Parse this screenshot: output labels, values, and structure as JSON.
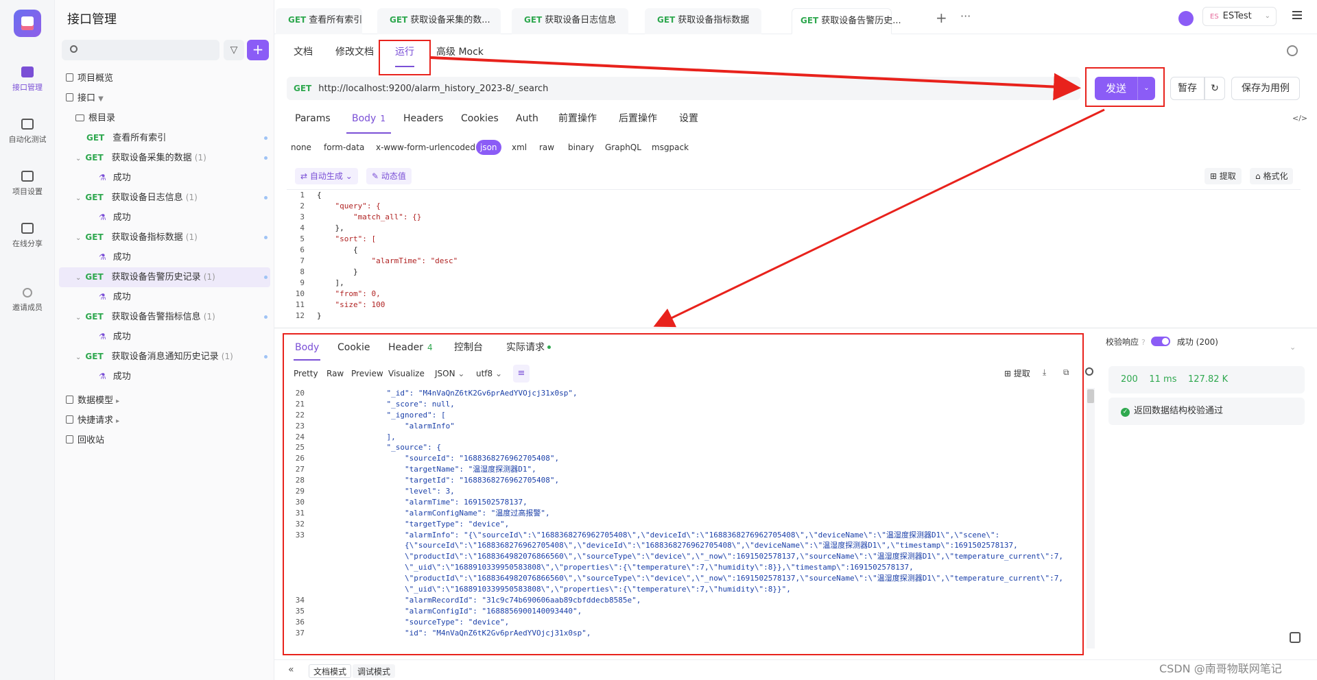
{
  "rail": {
    "items": [
      {
        "label": "接口管理"
      },
      {
        "label": "自动化测试"
      },
      {
        "label": "项目设置"
      },
      {
        "label": "在线分享"
      },
      {
        "label": "邀请成员"
      }
    ]
  },
  "sidebar": {
    "title": "接口管理",
    "overview": "项目概览",
    "api_root": "接口",
    "root_dir": "根目录",
    "apis": [
      {
        "method": "GET",
        "name": "查看所有索引",
        "count": ""
      },
      {
        "method": "GET",
        "name": "获取设备采集的数据",
        "count": "(1)",
        "case": "成功"
      },
      {
        "method": "GET",
        "name": "获取设备日志信息",
        "count": "(1)",
        "case": "成功"
      },
      {
        "method": "GET",
        "name": "获取设备指标数据",
        "count": "(1)",
        "case": "成功"
      },
      {
        "method": "GET",
        "name": "获取设备告警历史记录",
        "count": "(1)",
        "case": "成功"
      },
      {
        "method": "GET",
        "name": "获取设备告警指标信息",
        "count": "(1)",
        "case": "成功"
      },
      {
        "method": "GET",
        "name": "获取设备消息通知历史记录",
        "count": "(1)",
        "case": "成功"
      }
    ],
    "data_model": "数据模型",
    "quick_request": "快捷请求",
    "recycle": "回收站"
  },
  "tabs": [
    {
      "method": "GET",
      "label": "查看所有索引"
    },
    {
      "method": "GET",
      "label": "获取设备采集的数..."
    },
    {
      "method": "GET",
      "label": "获取设备日志信息"
    },
    {
      "method": "GET",
      "label": "获取设备指标数据"
    },
    {
      "method": "GET",
      "label": "获取设备告警历史..."
    }
  ],
  "env": {
    "badge": "ES",
    "name": "ESTest"
  },
  "subtabs": [
    "文档",
    "修改文档",
    "运行",
    "高级 Mock"
  ],
  "request": {
    "method": "GET",
    "url": "http://localhost:9200/alarm_history_2023-8/_search",
    "send": "发送",
    "save_temp": "暂存",
    "save_case": "保存为用例"
  },
  "reqtabs": [
    {
      "label": "Params",
      "n": ""
    },
    {
      "label": "Body",
      "n": "1"
    },
    {
      "label": "Headers",
      "n": ""
    },
    {
      "label": "Cookies",
      "n": ""
    },
    {
      "label": "Auth",
      "n": ""
    },
    {
      "label": "前置操作",
      "n": ""
    },
    {
      "label": "后置操作",
      "n": ""
    },
    {
      "label": "设置",
      "n": ""
    }
  ],
  "bodytypes": [
    "none",
    "form-data",
    "x-www-form-urlencoded",
    "json",
    "xml",
    "raw",
    "binary",
    "GraphQL",
    "msgpack"
  ],
  "body_tools": {
    "auto": "自动生成",
    "dynamic": "动态值",
    "extract": "提取",
    "format": "格式化"
  },
  "request_body": [
    "{",
    "    \"query\": {",
    "        \"match_all\": {}",
    "    },",
    "    \"sort\": [",
    "        {",
    "            \"alarmTime\": \"desc\"",
    "        }",
    "    ],",
    "    \"from\": 0,",
    "    \"size\": 100",
    "}"
  ],
  "response": {
    "tabs": [
      {
        "label": "Body",
        "n": ""
      },
      {
        "label": "Cookie",
        "n": ""
      },
      {
        "label": "Header",
        "n": "4"
      },
      {
        "label": "控制台",
        "n": ""
      },
      {
        "label": "实际请求",
        "n": ""
      }
    ],
    "formats": [
      "Pretty",
      "Raw",
      "Preview",
      "Visualize",
      "JSON",
      "utf8"
    ],
    "extract": "提取",
    "lines": [
      {
        "ln": "20",
        "text": "            \"_id\": \"M4nVaQnZ6tK2Gv6prAedYVOjcj31x0sp\","
      },
      {
        "ln": "21",
        "text": "            \"_score\": null,"
      },
      {
        "ln": "22",
        "text": "            \"_ignored\": ["
      },
      {
        "ln": "23",
        "text": "                \"alarmInfo\""
      },
      {
        "ln": "24",
        "text": "            ],"
      },
      {
        "ln": "25",
        "text": "            \"_source\": {"
      },
      {
        "ln": "26",
        "text": "                \"sourceId\": \"1688368276962705408\","
      },
      {
        "ln": "27",
        "text": "                \"targetName\": \"温湿度探测器D1\","
      },
      {
        "ln": "28",
        "text": "                \"targetId\": \"1688368276962705408\","
      },
      {
        "ln": "29",
        "text": "                \"level\": 3,"
      },
      {
        "ln": "30",
        "text": "                \"alarmTime\": 1691502578137,"
      },
      {
        "ln": "31",
        "text": "                \"alarmConfigName\": \"温度过高报警\","
      },
      {
        "ln": "32",
        "text": "                \"targetType\": \"device\","
      },
      {
        "ln": "33",
        "text": "                \"alarmInfo\": \"{\\\"sourceId\\\":\\\"1688368276962705408\\\",\\\"deviceId\\\":\\\"1688368276962705408\\\",\\\"deviceName\\\":\\\"温湿度探测器D1\\\",\\\"scene\\\":"
      },
      {
        "ln": "",
        "text": "                {\\\"sourceId\\\":\\\"1688368276962705408\\\",\\\"deviceId\\\":\\\"1688368276962705408\\\",\\\"deviceName\\\":\\\"温湿度探测器D1\\\",\\\"timestamp\\\":1691502578137,"
      },
      {
        "ln": "",
        "text": "                \\\"productId\\\":\\\"1688364982076866560\\\",\\\"sourceType\\\":\\\"device\\\",\\\"_now\\\":1691502578137,\\\"sourceName\\\":\\\"温湿度探测器D1\\\",\\\"temperature_current\\\":7,"
      },
      {
        "ln": "",
        "text": "                \\\"_uid\\\":\\\"1688910339950583808\\\",\\\"properties\\\":{\\\"temperature\\\":7,\\\"humidity\\\":8}},\\\"timestamp\\\":1691502578137,"
      },
      {
        "ln": "",
        "text": "                \\\"productId\\\":\\\"1688364982076866560\\\",\\\"sourceType\\\":\\\"device\\\",\\\"_now\\\":1691502578137,\\\"sourceName\\\":\\\"温湿度探测器D1\\\",\\\"temperature_current\\\":7,"
      },
      {
        "ln": "",
        "text": "                \\\"_uid\\\":\\\"1688910339950583808\\\",\\\"properties\\\":{\\\"temperature\\\":7,\\\"humidity\\\":8}}\","
      },
      {
        "ln": "34",
        "text": "                \"alarmRecordId\": \"31c9c74b690606aab89cbfddecb8585e\","
      },
      {
        "ln": "35",
        "text": "                \"alarmConfigId\": \"1688856900140093440\","
      },
      {
        "ln": "36",
        "text": "                \"sourceType\": \"device\","
      },
      {
        "ln": "37",
        "text": "                \"id\": \"M4nVaQnZ6tK2Gv6prAedYVOjcj31x0sp\","
      }
    ]
  },
  "validation": {
    "label": "校验响应",
    "result": "成功 (200)",
    "status": "200",
    "time": "11 ms",
    "size": "127.82 K",
    "message": "返回数据结构校验通过"
  },
  "bottom": {
    "doc_mode": "文档模式",
    "debug_mode": "调试模式"
  },
  "watermark": "CSDN @南哥物联网笔记"
}
